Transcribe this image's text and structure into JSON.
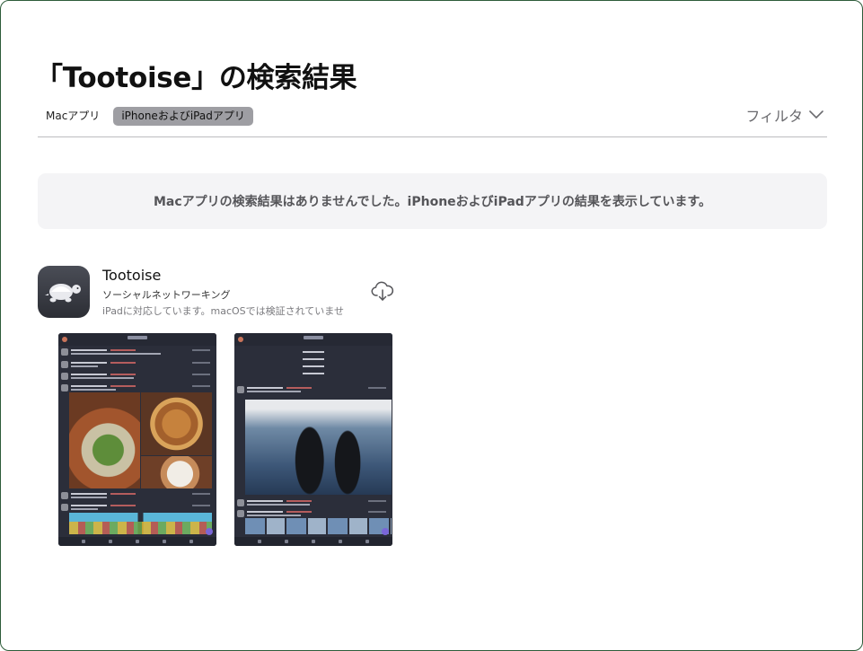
{
  "header": {
    "title": "「Tootoise」の検索結果"
  },
  "platform_tabs": [
    {
      "label": "Macアプリ",
      "selected": false
    },
    {
      "label": "iPhoneおよびiPadアプリ",
      "selected": true
    }
  ],
  "filter": {
    "label": "フィルタ",
    "icon": "chevron-down-icon"
  },
  "notice": {
    "text": "Macアプリの検索結果はありませんでした。iPhoneおよびiPadアプリの結果を表示しています。"
  },
  "result": {
    "name": "Tootoise",
    "category": "ソーシャルネットワーキング",
    "compatibility": "iPadに対応しています。macOSでは検証されていませ",
    "icon": "turtle-icon",
    "action_icon": "cloud-download-icon"
  },
  "colors": {
    "selected_tab_bg": "#9e9ea3",
    "notice_bg": "#f4f4f6",
    "app_icon_bg": "#3b3e46"
  }
}
